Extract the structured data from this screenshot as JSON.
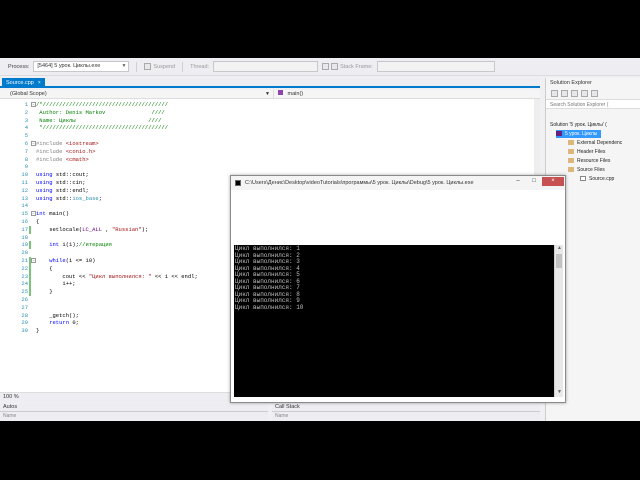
{
  "toolbar": {
    "process_label": "Process:",
    "process_value": "[5464] 5 урок. Циклы.exe",
    "suspend_label": "Suspend",
    "thread_label": "Thread:",
    "stack_frame_label": "Stack Frame:"
  },
  "editor": {
    "tab_title": "Source.cpp",
    "tab_close": "×",
    "scope": "(Global Scope)",
    "function": "main()",
    "zoom": "100 %",
    "lines": [
      {
        "n": "1",
        "html": "<span class='c-cm'>/*//////////////////////////////////////</span>"
      },
      {
        "n": "2",
        "html": "<span class='c-cm'> Author: Denis Markov              ////</span>"
      },
      {
        "n": "3",
        "html": "<span class='c-cm'> Name: Циклы                      ////</span>"
      },
      {
        "n": "4",
        "html": "<span class='c-cm'> *//////////////////////////////////////</span>"
      },
      {
        "n": "5",
        "html": ""
      },
      {
        "n": "6",
        "html": "<span class='c-pp'>#include</span> <span class='c-str'>&lt;iostream&gt;</span>"
      },
      {
        "n": "7",
        "html": "<span class='c-pp'>#include</span> <span class='c-str'>&lt;conio.h&gt;</span>"
      },
      {
        "n": "8",
        "html": "<span class='c-pp'>#include</span> <span class='c-str'>&lt;cmath&gt;</span>"
      },
      {
        "n": "9",
        "html": ""
      },
      {
        "n": "10",
        "html": "<span class='c-kw'>using</span> std::cout;"
      },
      {
        "n": "11",
        "html": "<span class='c-kw'>using</span> std::cin;"
      },
      {
        "n": "12",
        "html": "<span class='c-kw'>using</span> std::endl;"
      },
      {
        "n": "13",
        "html": "<span class='c-kw'>using</span> std::<span class='c-ty'>ios_base</span>;"
      },
      {
        "n": "14",
        "html": ""
      },
      {
        "n": "15",
        "html": "<span class='c-kw'>int</span> main()"
      },
      {
        "n": "16",
        "html": "{"
      },
      {
        "n": "17",
        "html": "    setlocale(<span class='c-mac'>LC_ALL</span> , <span class='c-str'>\"Russian\"</span>);"
      },
      {
        "n": "18",
        "html": ""
      },
      {
        "n": "19",
        "html": "    <span class='c-kw'>int</span> i(1);<span class='c-cm'>//итерация</span>"
      },
      {
        "n": "20",
        "html": ""
      },
      {
        "n": "21",
        "html": "    <span class='c-kw'>while</span>(i &lt;= 10)"
      },
      {
        "n": "22",
        "html": "    {"
      },
      {
        "n": "23",
        "html": "        cout &lt;&lt; <span class='c-str'>\"Цикл выполнился: \"</span> &lt;&lt; i &lt;&lt; endl;"
      },
      {
        "n": "24",
        "html": "        i++;"
      },
      {
        "n": "25",
        "html": "    }"
      },
      {
        "n": "26",
        "html": ""
      },
      {
        "n": "27",
        "html": ""
      },
      {
        "n": "28",
        "html": "    _getch();"
      },
      {
        "n": "29",
        "html": "    <span class='c-kw'>return</span> 0;"
      },
      {
        "n": "30",
        "html": "}"
      }
    ]
  },
  "panes": {
    "autos_title": "Autos",
    "autos_header": "Name",
    "callstack_title": "Call Stack",
    "callstack_header": "Name"
  },
  "solution_explorer": {
    "title": "Solution Explorer",
    "search_placeholder": "Search Solution Explorer (",
    "items": [
      {
        "label": "Solution '5 урок. Циклы' (",
        "icon": "solution-icon"
      },
      {
        "label": "5 урок. Циклы",
        "icon": "project-icon"
      },
      {
        "label": "External Dependenc",
        "icon": "folder-icon"
      },
      {
        "label": "Header Files",
        "icon": "folder-icon"
      },
      {
        "label": "Resource Files",
        "icon": "folder-icon"
      },
      {
        "label": "Source Files",
        "icon": "folder-icon"
      },
      {
        "label": "Source.cpp",
        "icon": "cpp-file-icon"
      }
    ]
  },
  "console": {
    "title": "C:\\Users\\Денис\\Desktop\\videoTutorials\\программы\\5 урок. Циклы\\Debug\\5 урок. Циклы.exe",
    "minimize": "–",
    "maximize": "□",
    "close": "×",
    "output": "Цикл выполнился: 1\nЦикл выполнился: 2\nЦикл выполнился: 3\nЦикл выполнился: 4\nЦикл выполнился: 5\nЦикл выполнился: 6\nЦикл выполнился: 7\nЦикл выполнился: 8\nЦикл выполнился: 9\nЦикл выполнился: 10"
  }
}
